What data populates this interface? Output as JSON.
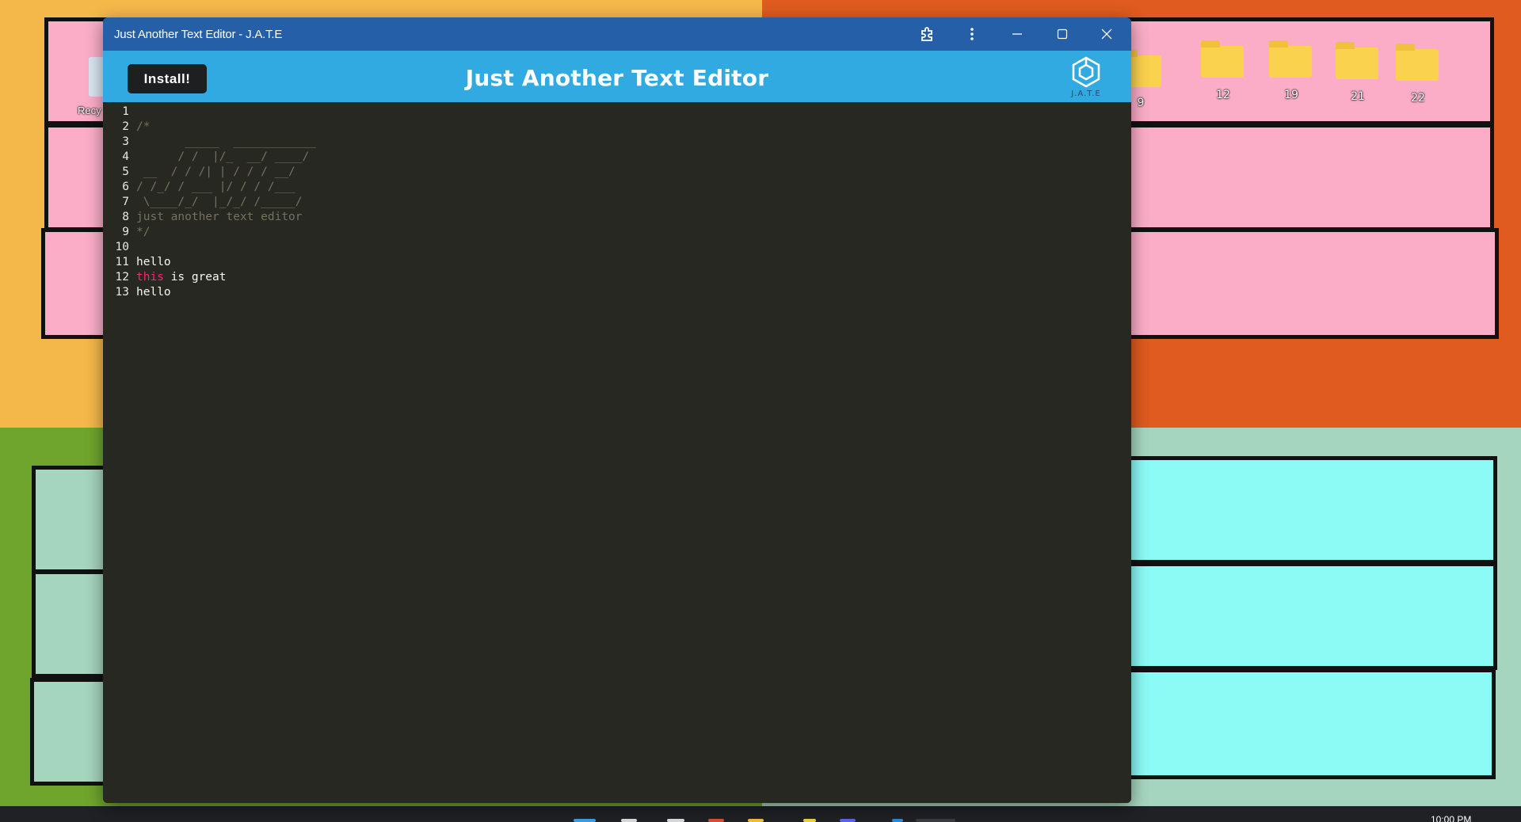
{
  "desktop": {
    "recycle_bin_label": "Recy",
    "folders": [
      {
        "label": "9"
      },
      {
        "label": "12"
      },
      {
        "label": "19"
      },
      {
        "label": "21"
      },
      {
        "label": "22"
      }
    ]
  },
  "window": {
    "title": "Just Another Text Editor - J.A.T.E",
    "controls": [
      "extensions-icon",
      "menu-icon",
      "minimize-icon",
      "maximize-icon",
      "close-icon"
    ]
  },
  "header": {
    "install_label": "Install!",
    "app_title": "Just Another Text Editor",
    "logo_text": "J.A.T.E",
    "background_color": "#31a9e1"
  },
  "editor": {
    "lines": [
      {
        "num": "1",
        "text": ""
      },
      {
        "num": "2",
        "text": "/*"
      },
      {
        "num": "3",
        "text": "       _____  ____________"
      },
      {
        "num": "4",
        "text": "      / /  |/_  __/ ____/"
      },
      {
        "num": "5",
        "text": " __  / / /| | / / / __/"
      },
      {
        "num": "6",
        "text": "/ /_/ / ___ |/ / / /___"
      },
      {
        "num": "7",
        "text": " \\____/_/  |_/_/ /_____/"
      },
      {
        "num": "8",
        "text": "just another text editor"
      },
      {
        "num": "9",
        "text": "*/"
      },
      {
        "num": "10",
        "text": ""
      },
      {
        "num": "11",
        "text": "hello"
      },
      {
        "num": "12",
        "text_kw": "this",
        "text_rest": " is great"
      },
      {
        "num": "13",
        "text": "hello"
      }
    ]
  },
  "taskbar": {
    "clock": "10:00 PM"
  }
}
